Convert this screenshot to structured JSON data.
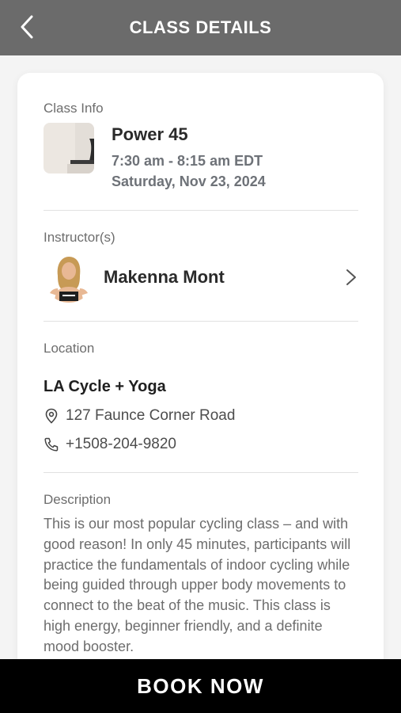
{
  "header": {
    "title": "CLASS DETAILS"
  },
  "class_info": {
    "label": "Class Info",
    "name": "Power 45",
    "time": "7:30 am - 8:15 am EDT",
    "date": "Saturday, Nov 23, 2024"
  },
  "instructor": {
    "label": "Instructor(s)",
    "name": "Makenna Mont"
  },
  "location": {
    "label": "Location",
    "name": "LA Cycle + Yoga",
    "address": "127 Faunce Corner Road",
    "phone": "+1508-204-9820"
  },
  "description": {
    "label": "Description",
    "text": "This is our most popular cycling class – and with good reason! In only 45 minutes, participants will practice the fundamentals of indoor cycling while being guided through upper body movements to connect to the beat of the music. This class is high energy, beginner friendly, and a definite mood booster."
  },
  "footer": {
    "book_label": "BOOK NOW"
  }
}
